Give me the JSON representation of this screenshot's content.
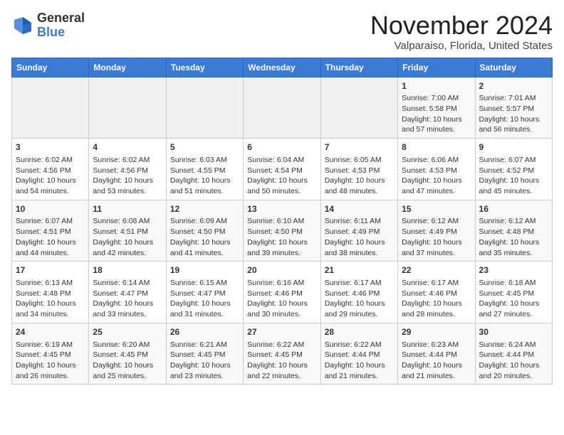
{
  "header": {
    "logo_line1": "General",
    "logo_line2": "Blue",
    "month": "November 2024",
    "location": "Valparaiso, Florida, United States"
  },
  "weekdays": [
    "Sunday",
    "Monday",
    "Tuesday",
    "Wednesday",
    "Thursday",
    "Friday",
    "Saturday"
  ],
  "weeks": [
    [
      {
        "day": "",
        "info": ""
      },
      {
        "day": "",
        "info": ""
      },
      {
        "day": "",
        "info": ""
      },
      {
        "day": "",
        "info": ""
      },
      {
        "day": "",
        "info": ""
      },
      {
        "day": "1",
        "info": "Sunrise: 7:00 AM\nSunset: 5:58 PM\nDaylight: 10 hours and 57 minutes."
      },
      {
        "day": "2",
        "info": "Sunrise: 7:01 AM\nSunset: 5:57 PM\nDaylight: 10 hours and 56 minutes."
      }
    ],
    [
      {
        "day": "3",
        "info": "Sunrise: 6:02 AM\nSunset: 4:56 PM\nDaylight: 10 hours and 54 minutes."
      },
      {
        "day": "4",
        "info": "Sunrise: 6:02 AM\nSunset: 4:56 PM\nDaylight: 10 hours and 53 minutes."
      },
      {
        "day": "5",
        "info": "Sunrise: 6:03 AM\nSunset: 4:55 PM\nDaylight: 10 hours and 51 minutes."
      },
      {
        "day": "6",
        "info": "Sunrise: 6:04 AM\nSunset: 4:54 PM\nDaylight: 10 hours and 50 minutes."
      },
      {
        "day": "7",
        "info": "Sunrise: 6:05 AM\nSunset: 4:53 PM\nDaylight: 10 hours and 48 minutes."
      },
      {
        "day": "8",
        "info": "Sunrise: 6:06 AM\nSunset: 4:53 PM\nDaylight: 10 hours and 47 minutes."
      },
      {
        "day": "9",
        "info": "Sunrise: 6:07 AM\nSunset: 4:52 PM\nDaylight: 10 hours and 45 minutes."
      }
    ],
    [
      {
        "day": "10",
        "info": "Sunrise: 6:07 AM\nSunset: 4:51 PM\nDaylight: 10 hours and 44 minutes."
      },
      {
        "day": "11",
        "info": "Sunrise: 6:08 AM\nSunset: 4:51 PM\nDaylight: 10 hours and 42 minutes."
      },
      {
        "day": "12",
        "info": "Sunrise: 6:09 AM\nSunset: 4:50 PM\nDaylight: 10 hours and 41 minutes."
      },
      {
        "day": "13",
        "info": "Sunrise: 6:10 AM\nSunset: 4:50 PM\nDaylight: 10 hours and 39 minutes."
      },
      {
        "day": "14",
        "info": "Sunrise: 6:11 AM\nSunset: 4:49 PM\nDaylight: 10 hours and 38 minutes."
      },
      {
        "day": "15",
        "info": "Sunrise: 6:12 AM\nSunset: 4:49 PM\nDaylight: 10 hours and 37 minutes."
      },
      {
        "day": "16",
        "info": "Sunrise: 6:12 AM\nSunset: 4:48 PM\nDaylight: 10 hours and 35 minutes."
      }
    ],
    [
      {
        "day": "17",
        "info": "Sunrise: 6:13 AM\nSunset: 4:48 PM\nDaylight: 10 hours and 34 minutes."
      },
      {
        "day": "18",
        "info": "Sunrise: 6:14 AM\nSunset: 4:47 PM\nDaylight: 10 hours and 33 minutes."
      },
      {
        "day": "19",
        "info": "Sunrise: 6:15 AM\nSunset: 4:47 PM\nDaylight: 10 hours and 31 minutes."
      },
      {
        "day": "20",
        "info": "Sunrise: 6:16 AM\nSunset: 4:46 PM\nDaylight: 10 hours and 30 minutes."
      },
      {
        "day": "21",
        "info": "Sunrise: 6:17 AM\nSunset: 4:46 PM\nDaylight: 10 hours and 29 minutes."
      },
      {
        "day": "22",
        "info": "Sunrise: 6:17 AM\nSunset: 4:46 PM\nDaylight: 10 hours and 28 minutes."
      },
      {
        "day": "23",
        "info": "Sunrise: 6:18 AM\nSunset: 4:45 PM\nDaylight: 10 hours and 27 minutes."
      }
    ],
    [
      {
        "day": "24",
        "info": "Sunrise: 6:19 AM\nSunset: 4:45 PM\nDaylight: 10 hours and 26 minutes."
      },
      {
        "day": "25",
        "info": "Sunrise: 6:20 AM\nSunset: 4:45 PM\nDaylight: 10 hours and 25 minutes."
      },
      {
        "day": "26",
        "info": "Sunrise: 6:21 AM\nSunset: 4:45 PM\nDaylight: 10 hours and 23 minutes."
      },
      {
        "day": "27",
        "info": "Sunrise: 6:22 AM\nSunset: 4:45 PM\nDaylight: 10 hours and 22 minutes."
      },
      {
        "day": "28",
        "info": "Sunrise: 6:22 AM\nSunset: 4:44 PM\nDaylight: 10 hours and 21 minutes."
      },
      {
        "day": "29",
        "info": "Sunrise: 6:23 AM\nSunset: 4:44 PM\nDaylight: 10 hours and 21 minutes."
      },
      {
        "day": "30",
        "info": "Sunrise: 6:24 AM\nSunset: 4:44 PM\nDaylight: 10 hours and 20 minutes."
      }
    ]
  ]
}
